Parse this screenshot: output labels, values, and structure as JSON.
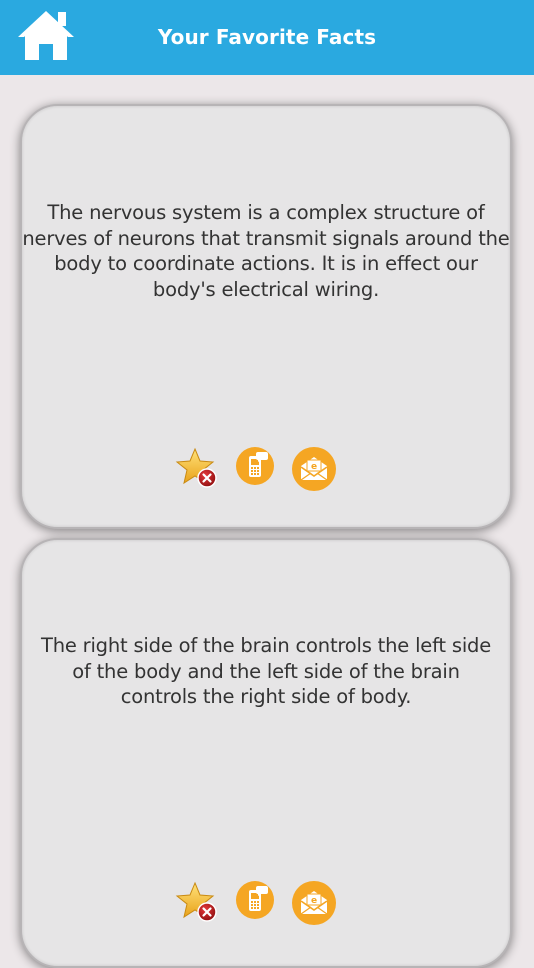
{
  "header": {
    "title": "Your Favorite Facts",
    "background": "#2aa9e0",
    "home_icon": "home-icon"
  },
  "facts": [
    {
      "text": "The nervous system is a complex structure of nerves of neurons that transmit signals around the body to coordinate actions. It is in effect our body's electrical wiring.",
      "actions": [
        "remove-favorite-icon",
        "sms-share-icon",
        "email-share-icon"
      ]
    },
    {
      "text": "The right side of the brain controls the left side of the body and the left side of the brain controls the right side of body.",
      "actions": [
        "remove-favorite-icon",
        "sms-share-icon",
        "email-share-icon"
      ]
    }
  ],
  "colors": {
    "accent_orange": "#f5a623",
    "card_background": "#e6e5e6",
    "page_background": "#ece7e9"
  }
}
